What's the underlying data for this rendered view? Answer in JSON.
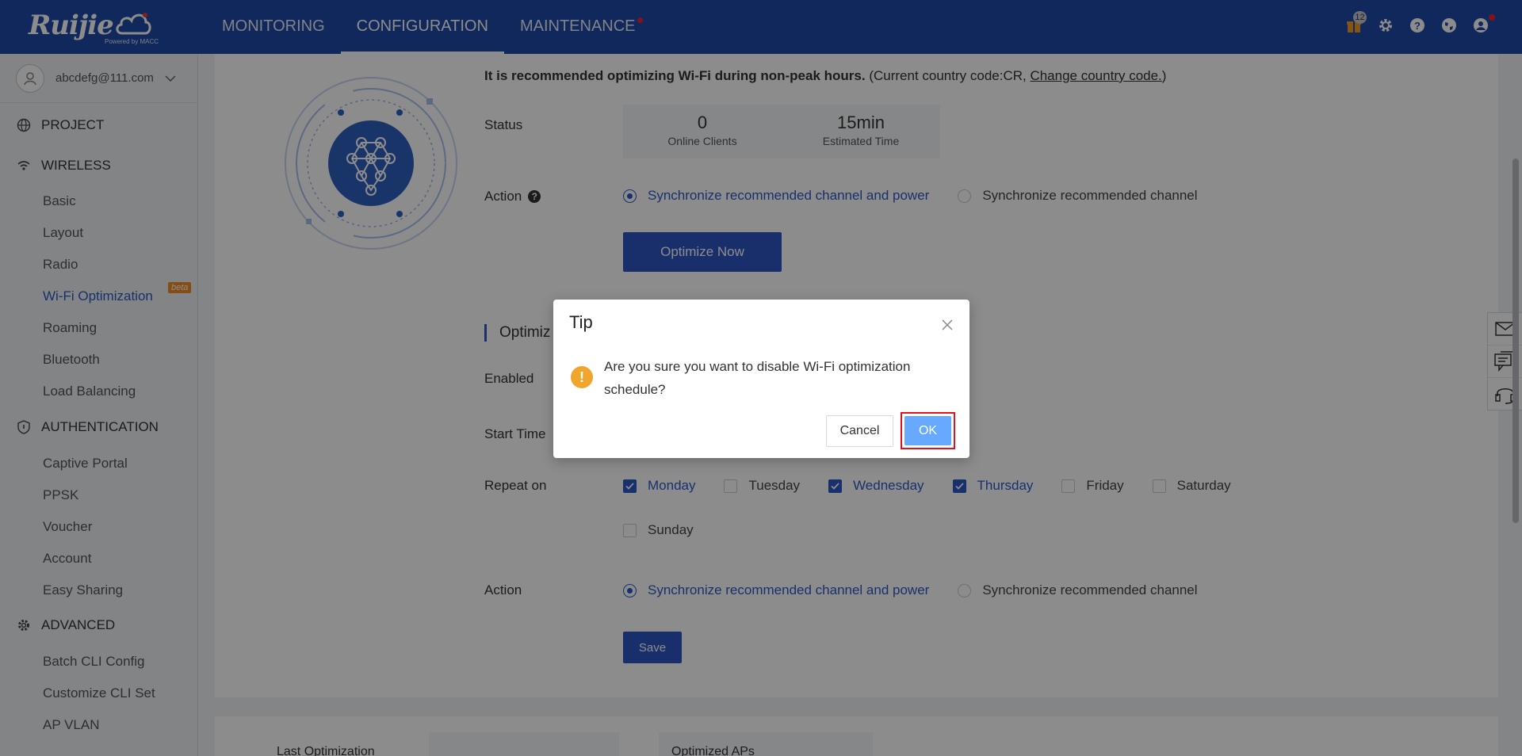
{
  "header": {
    "logo_text": "Ruijie",
    "logo_tag": "Powered by MACC",
    "nav": [
      {
        "label": "MONITORING"
      },
      {
        "label": "CONFIGURATION"
      },
      {
        "label": "MAINTENANCE"
      }
    ],
    "notification_count": "12",
    "icons": [
      "gift-icon",
      "gear-icon",
      "help-icon",
      "globe-icon",
      "user-icon"
    ]
  },
  "sidebar": {
    "account_email": "abcdefg@111.com",
    "groups": {
      "project": "PROJECT",
      "wireless": "WIRELESS",
      "authentication": "AUTHENTICATION",
      "advanced": "ADVANCED"
    },
    "wireless_items": [
      "Basic",
      "Layout",
      "Radio",
      "Wi-Fi Optimization",
      "Roaming",
      "Bluetooth",
      "Load Balancing"
    ],
    "beta_label": "beta",
    "auth_items": [
      "Captive Portal",
      "PPSK",
      "Voucher",
      "Account",
      "Easy Sharing"
    ],
    "advanced_items": [
      "Batch CLI Config",
      "Customize CLI Set",
      "AP VLAN"
    ]
  },
  "main": {
    "recommend_bold": "It is recommended optimizing Wi-Fi during non-peak hours.",
    "recommend_rest": " (Current country code:CR, ",
    "change_country": "Change country code.",
    "recommend_end": ")",
    "status_label": "Status",
    "stats": [
      {
        "value": "0",
        "label": "Online Clients"
      },
      {
        "value": "15min",
        "label": "Estimated Time"
      }
    ],
    "action_label": "Action",
    "action_options": [
      "Synchronize recommended channel and power",
      "Synchronize recommended channel"
    ],
    "optimize_button": "Optimize Now",
    "schedule_title": "Optimiz",
    "enabled_label": "Enabled",
    "start_time_label": "Start Time",
    "repeat_label": "Repeat on",
    "days": [
      {
        "label": "Monday",
        "checked": true
      },
      {
        "label": "Tuesday",
        "checked": false
      },
      {
        "label": "Wednesday",
        "checked": true
      },
      {
        "label": "Thursday",
        "checked": true
      },
      {
        "label": "Friday",
        "checked": false
      },
      {
        "label": "Saturday",
        "checked": false
      },
      {
        "label": "Sunday",
        "checked": false
      }
    ],
    "action2_label": "Action",
    "save_button": "Save",
    "bottom_left": "Last Optimization",
    "bottom_right": "Optimized APs"
  },
  "modal": {
    "title": "Tip",
    "message": "Are you sure you want to disable Wi-Fi optimization schedule?",
    "cancel": "Cancel",
    "ok": "OK"
  },
  "colors": {
    "header_bg": "#1f4aa8",
    "accent": "#2c5ac7",
    "ok_button": "#66a9ff",
    "warning": "#f0a52c",
    "highlight_border": "#e3101f"
  }
}
